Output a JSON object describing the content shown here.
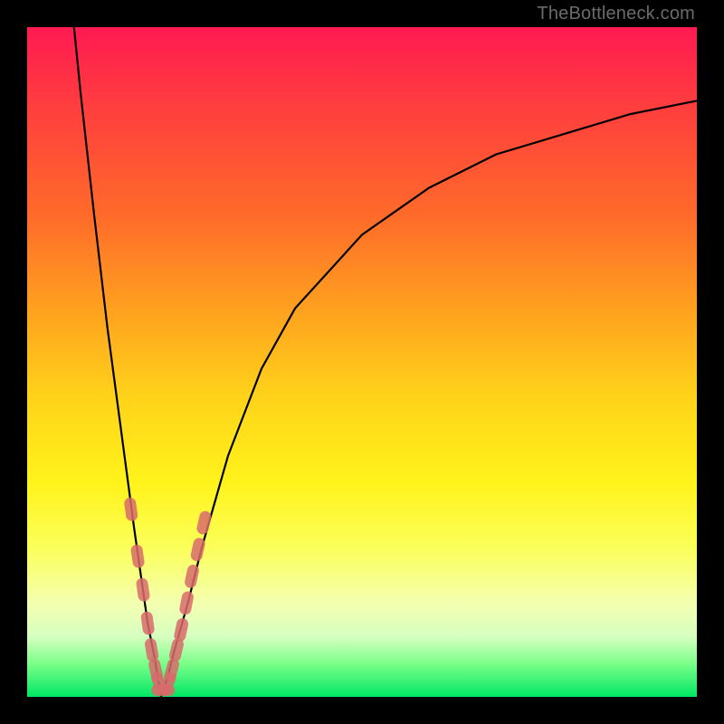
{
  "watermark": "TheBottleneck.com",
  "colors": {
    "frame": "#000000",
    "gradient_top": "#ff1a52",
    "gradient_bottom": "#00e765",
    "curve": "#000000",
    "markers": "#d86b6b"
  },
  "chart_data": {
    "type": "line",
    "title": "",
    "xlabel": "",
    "ylabel": "",
    "xlim": [
      0,
      100
    ],
    "ylim": [
      0,
      100
    ],
    "description": "Two V-shaped bottleneck curves sharing a minimum near x≈20 against a vertical red-to-green gradient background. Left branch rises steeply to 100 as x→0; right branch rises asymptotically toward ~90 as x→100.",
    "series": [
      {
        "name": "left-branch",
        "x": [
          7,
          8,
          10,
          12,
          14,
          16,
          17,
          18,
          19,
          19.5,
          20
        ],
        "values": [
          100,
          90,
          72,
          55,
          40,
          25,
          18,
          11,
          6,
          3,
          0
        ]
      },
      {
        "name": "right-branch",
        "x": [
          20,
          21,
          22,
          24,
          26,
          30,
          35,
          40,
          50,
          60,
          70,
          80,
          90,
          100
        ],
        "values": [
          0,
          3,
          7,
          14,
          22,
          36,
          49,
          58,
          69,
          76,
          81,
          84,
          87,
          89
        ]
      }
    ],
    "markers": {
      "name": "highlighted-points",
      "style": "salmon-capsule",
      "points": [
        {
          "x": 15.5,
          "y": 28
        },
        {
          "x": 16.5,
          "y": 21
        },
        {
          "x": 17.3,
          "y": 16
        },
        {
          "x": 18.0,
          "y": 11
        },
        {
          "x": 18.6,
          "y": 7
        },
        {
          "x": 19.2,
          "y": 4
        },
        {
          "x": 19.7,
          "y": 2
        },
        {
          "x": 20.3,
          "y": 1
        },
        {
          "x": 21.0,
          "y": 2
        },
        {
          "x": 21.6,
          "y": 4
        },
        {
          "x": 22.3,
          "y": 7
        },
        {
          "x": 23.0,
          "y": 10
        },
        {
          "x": 23.8,
          "y": 14
        },
        {
          "x": 24.6,
          "y": 18
        },
        {
          "x": 25.5,
          "y": 22
        },
        {
          "x": 26.4,
          "y": 26
        }
      ]
    }
  }
}
